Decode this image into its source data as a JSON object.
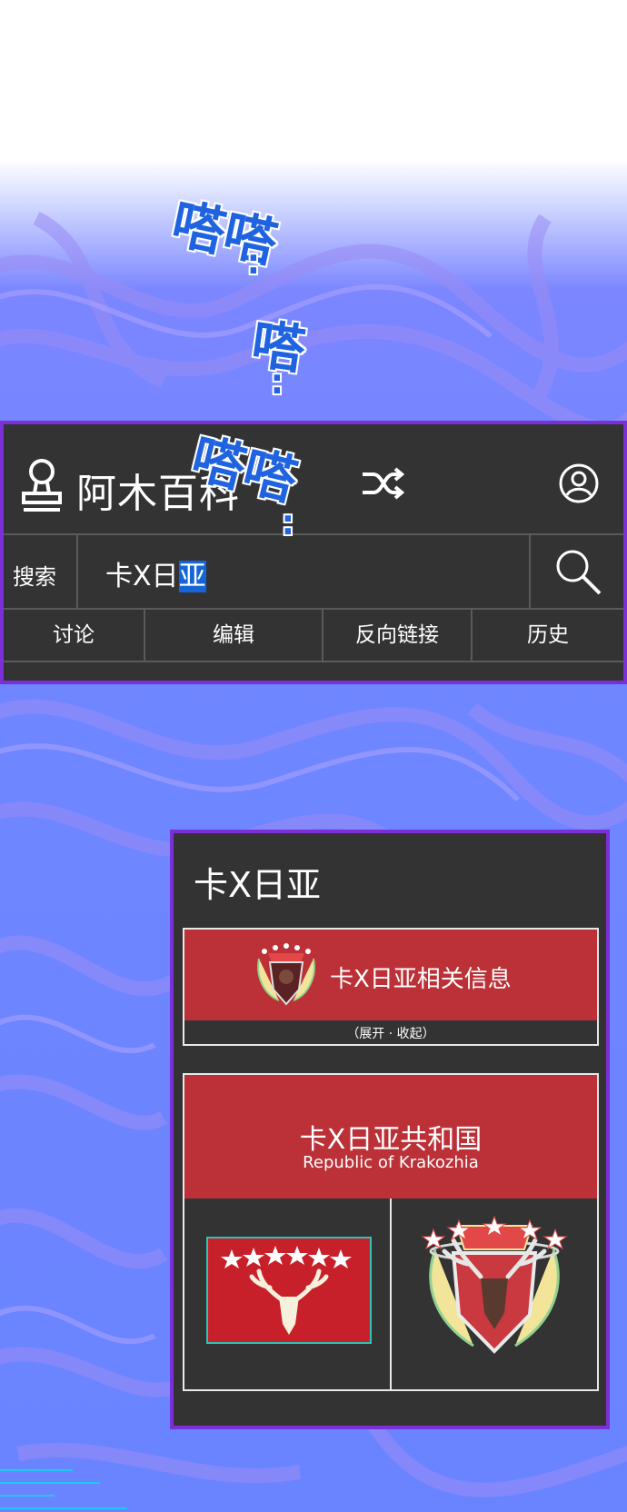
{
  "wiki": {
    "title": "阿木百科",
    "search_label": "搜索",
    "search_value_plain": "卡X日",
    "search_value_selected": "亚",
    "tabs": [
      {
        "label": "讨论"
      },
      {
        "label": "编辑"
      },
      {
        "label": "反向链接"
      },
      {
        "label": "历史"
      }
    ]
  },
  "sfx": {
    "first": "嗒嗒",
    "second": "嗒",
    "third": "嗒嗒"
  },
  "article": {
    "title": "卡X日亚",
    "info_label": "卡X日亚相关信息",
    "info_toggle": "（展开 · 收起）",
    "country_name": "卡X日亚共和国",
    "country_name_en": "Republic of Krakozhia"
  },
  "colors": {
    "panel_bg": "#333333",
    "panel_border": "#7b2fd6",
    "banner_red": "#bb3137",
    "sfx_blue": "#1f63e0",
    "selection_blue": "#1565d8",
    "background_blue": "#6f86ff"
  }
}
